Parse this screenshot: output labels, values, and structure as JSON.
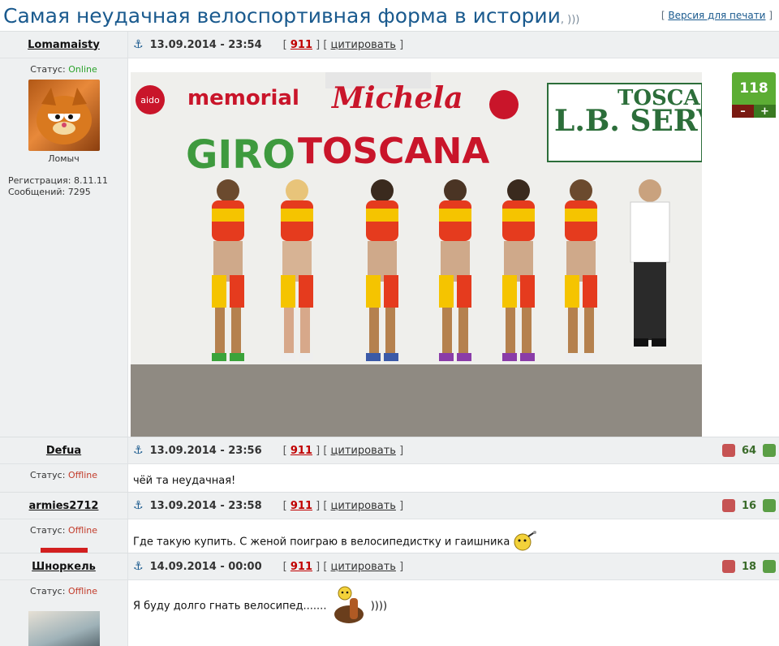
{
  "topic": {
    "title": "Самая неудачная велоспортивная форма в истории",
    "title_suffix": ", )))"
  },
  "print_link": {
    "open": "[",
    "label": "Версия для печати",
    "close": "]"
  },
  "anchor_icon": "anchor-icon",
  "posts": [
    {
      "author": "Lomamaisty",
      "status_label": "Статус:",
      "status": "Online",
      "avatar_caption": "Ломыч",
      "registration": "Регистрация: 8.11.11",
      "messages": "Сообщений: 7295",
      "date": "13.09.2014 - 23:54",
      "post_no": "911",
      "quote_label": "цитировать",
      "rating": "118",
      "minus": "–",
      "plus": "+",
      "photo": {
        "banner_left": "memorial",
        "banner_center": "Michela",
        "banner_right": "L.B. SERVICE",
        "banner_right_top": "TOSCA",
        "brand_giro": "GIRO",
        "brand_toscana": "TOSCANA",
        "brand_aido": "aido"
      }
    },
    {
      "author": "Defua",
      "status_label": "Статус:",
      "status": "Offline",
      "date": "13.09.2014 - 23:56",
      "post_no": "911",
      "quote_label": "цитировать",
      "rating": "64",
      "text": "чёй та неудачная!"
    },
    {
      "author": "armies2712",
      "status_label": "Статус:",
      "status": "Offline",
      "date": "13.09.2014 - 23:58",
      "post_no": "911",
      "quote_label": "цитировать",
      "rating": "16",
      "text": "Где такую купить. С женой поиграю в велосипедистку и гаишника"
    },
    {
      "author": "Шноркель",
      "status_label": "Статус:",
      "status": "Offline",
      "date": "14.09.2014 - 00:00",
      "post_no": "911",
      "quote_label": "цитировать",
      "rating": "18",
      "text": "Я буду долго гнать велосипед.......",
      "text_after": "))))"
    }
  ],
  "colors": {
    "title": "#1a5a8e",
    "online": "#2aa22a",
    "offline": "#c23b2a",
    "post_no": "#c00000",
    "rating_green": "#5cad34"
  }
}
